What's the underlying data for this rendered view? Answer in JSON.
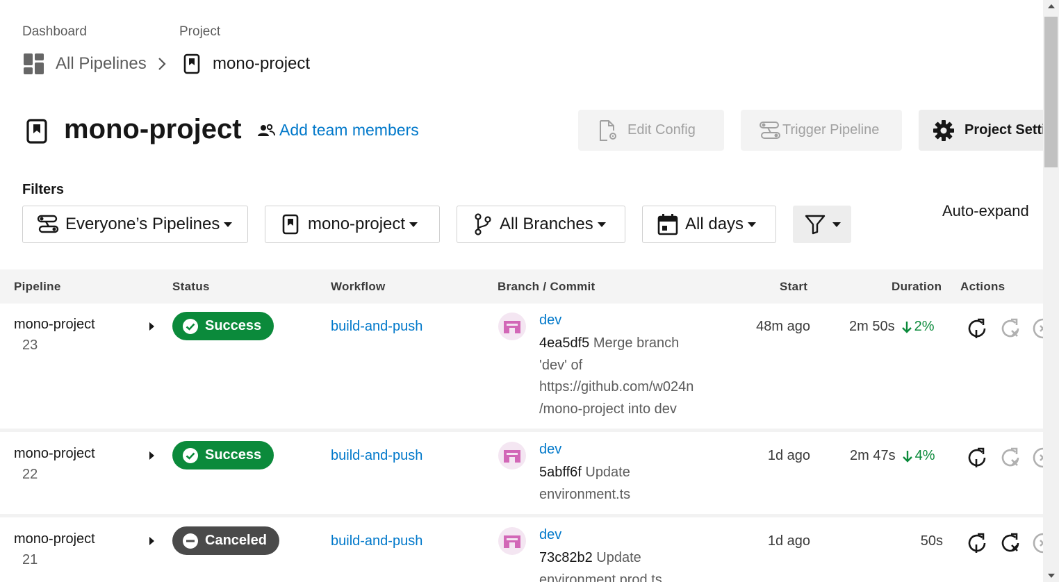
{
  "breadcrumb": {
    "dashboard_label": "Dashboard",
    "project_label": "Project",
    "all_pipelines": "All Pipelines",
    "current_project": "mono-project"
  },
  "header": {
    "title": "mono-project",
    "add_team": "Add team members",
    "edit_config": "Edit Config",
    "trigger_pipeline": "Trigger Pipeline",
    "project_settings": "Project Setti"
  },
  "filters": {
    "label": "Filters",
    "pipelines": "Everyone’s Pipelines",
    "project": "mono-project",
    "branches": "All Branches",
    "days": "All days",
    "auto_expand": "Auto-expand"
  },
  "table": {
    "columns": [
      "Pipeline",
      "Status",
      "Workflow",
      "Branch / Commit",
      "Start",
      "Duration",
      "Actions"
    ],
    "rows": [
      {
        "pipeline": "mono-project",
        "number": "23",
        "status": "Success",
        "workflow": "build-and-push",
        "branch": "dev",
        "hash": "4ea5df5",
        "message_lines": [
          " Merge branch",
          "'dev' of",
          "https://github.com/w024n",
          "/mono-project into dev"
        ],
        "start": "48m ago",
        "duration": "2m 50s",
        "change": "2%"
      },
      {
        "pipeline": "mono-project",
        "number": "22",
        "status": "Success",
        "workflow": "build-and-push",
        "branch": "dev",
        "hash": "5abff6f",
        "message_lines": [
          " Update",
          "environment.ts"
        ],
        "start": "1d ago",
        "duration": "2m 47s",
        "change": "4%"
      },
      {
        "pipeline": "mono-project",
        "number": "21",
        "status": "Canceled",
        "workflow": "build-and-push",
        "branch": "dev",
        "hash": "73c82b2",
        "message_lines": [
          " Update",
          "environment.prod.ts"
        ],
        "start": "1d ago",
        "duration": "50s",
        "change": ""
      }
    ]
  },
  "colors": {
    "success": "#0b8a3b",
    "canceled": "#4a4a4a",
    "link": "#0078ca"
  }
}
